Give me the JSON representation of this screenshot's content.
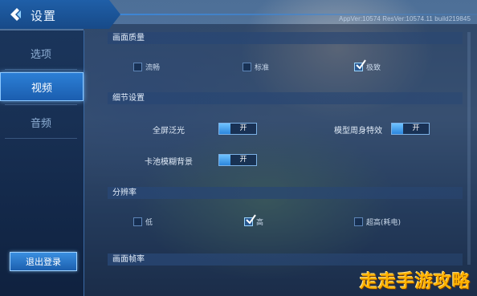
{
  "header": {
    "title": "设置",
    "version": "AppVer:10574  ResVer:10574.11  build219845"
  },
  "sidebar": {
    "items": [
      {
        "label": "选项"
      },
      {
        "label": "视频"
      },
      {
        "label": "音频"
      }
    ],
    "active_index": 1,
    "logout_label": "退出登录"
  },
  "quality": {
    "section_title": "画面质量",
    "options": [
      {
        "label": "流畅",
        "checked": false
      },
      {
        "label": "标准",
        "checked": false
      },
      {
        "label": "极致",
        "checked": true
      }
    ]
  },
  "detail": {
    "section_title": "细节设置",
    "fullscreen_glow": {
      "label": "全屏泛光",
      "value": "开"
    },
    "model_effect": {
      "label": "模型周身特效",
      "value": "开"
    },
    "card_blur": {
      "label": "卡池模糊背景",
      "value": "开"
    }
  },
  "resolution": {
    "section_title": "分辨率",
    "options": [
      {
        "label": "低",
        "checked": false
      },
      {
        "label": "高",
        "checked": true
      },
      {
        "label": "超高(耗电)",
        "checked": false
      }
    ]
  },
  "framerate": {
    "section_title": "画面帧率"
  },
  "watermark": "走走手游攻略",
  "colors": {
    "accent": "#2c7fd6",
    "watermark": "#ffb300"
  }
}
